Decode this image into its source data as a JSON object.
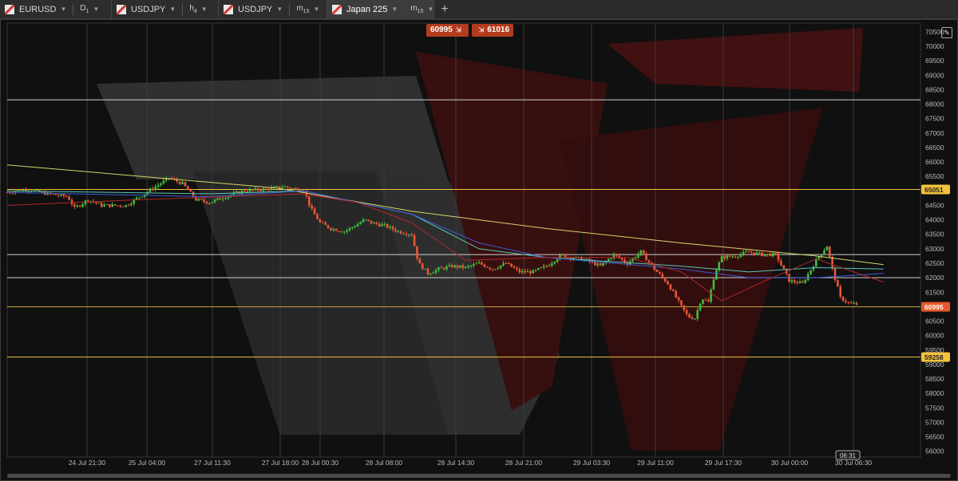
{
  "tabs": [
    {
      "symbol": "EURUSD",
      "timeframe_main": "D",
      "timeframe_sub": "1",
      "active": false
    },
    {
      "symbol": "USDJPY",
      "timeframe_main": "h",
      "timeframe_sub": "4",
      "active": false
    },
    {
      "symbol": "USDJPY",
      "timeframe_main": "m",
      "timeframe_sub": "15",
      "active": false
    },
    {
      "symbol": "Japan 225",
      "timeframe_main": "m",
      "timeframe_sub": "15",
      "active": true
    }
  ],
  "add_tab_label": "+",
  "quotes": {
    "bid": "60995",
    "bid_arrow": "⇲",
    "ask_arrow": "⇲",
    "ask": "61016"
  },
  "settings_icon": "edit-icon",
  "colors": {
    "bull": "#3fbf3f",
    "bear": "#e8583a",
    "ma_yellow": "#d6d46a",
    "ma_blue": "#3a5bd6",
    "ma_red": "#b2282b",
    "ma_cyan": "#56c7b8",
    "bid_badge": "#e8582a",
    "level_badge": "#f2c23c"
  },
  "chart_data": {
    "type": "candlestick",
    "symbol": "Japan 225",
    "timeframe": "m15",
    "y_axis": {
      "ticks": [
        "70500",
        "70000",
        "69500",
        "69000",
        "68500",
        "68000",
        "67500",
        "67000",
        "66500",
        "66000",
        "65500",
        "65000",
        "64500",
        "64000",
        "63500",
        "63000",
        "62500",
        "62000",
        "61500",
        "61000",
        "60500",
        "60000",
        "59500",
        "59000",
        "58500",
        "58000",
        "57500",
        "57000",
        "56500",
        "56000"
      ],
      "range": [
        55800,
        70800
      ]
    },
    "x_axis": {
      "labels": [
        "24 Jul 21:30",
        "25 Jul 04:00",
        "27 Jul 11:30",
        "27 Jul 18:00",
        "28 Jul 00:30",
        "28 Jul 08:00",
        "28 Jul 14:30",
        "28 Jul 21:00",
        "29 Jul 03:30",
        "29 Jul 11:00",
        "29 Jul 17:30",
        "30 Jul 00:00",
        "30 Jul 06:30"
      ],
      "current_marker": "06:31"
    },
    "horizontal_levels": [
      {
        "value": 68150,
        "color": "#d0d0d0",
        "label": ""
      },
      {
        "value": 65051,
        "color": "#f2c23c",
        "label": "65051"
      },
      {
        "value": 62800,
        "color": "#d0d0d0",
        "label": ""
      },
      {
        "value": 62000,
        "color": "#d0d0d0",
        "label": ""
      },
      {
        "value": 60995,
        "color": "#c8a83c",
        "label": "60995"
      },
      {
        "value": 59258,
        "color": "#f2c23c",
        "label": "59258"
      }
    ],
    "anchors": [
      [
        0,
        64950
      ],
      [
        15,
        65050
      ],
      [
        30,
        64900
      ],
      [
        45,
        64800
      ],
      [
        50,
        64400
      ],
      [
        60,
        64700
      ],
      [
        70,
        64500
      ],
      [
        88,
        64500
      ],
      [
        100,
        64850
      ],
      [
        110,
        65150
      ],
      [
        120,
        65450
      ],
      [
        130,
        65250
      ],
      [
        140,
        64700
      ],
      [
        150,
        64600
      ],
      [
        165,
        64850
      ],
      [
        175,
        65000
      ],
      [
        190,
        65050
      ],
      [
        205,
        65150
      ],
      [
        215,
        65050
      ],
      [
        220,
        65050
      ],
      [
        225,
        64400
      ],
      [
        232,
        63900
      ],
      [
        240,
        63700
      ],
      [
        250,
        63600
      ],
      [
        258,
        63800
      ],
      [
        265,
        64000
      ],
      [
        270,
        63900
      ],
      [
        280,
        63800
      ],
      [
        290,
        63600
      ],
      [
        300,
        63500
      ],
      [
        305,
        62500
      ],
      [
        312,
        62150
      ],
      [
        320,
        62300
      ],
      [
        330,
        62400
      ],
      [
        340,
        62350
      ],
      [
        350,
        62500
      ],
      [
        360,
        62300
      ],
      [
        370,
        62500
      ],
      [
        380,
        62200
      ],
      [
        390,
        62200
      ],
      [
        400,
        62400
      ],
      [
        410,
        62750
      ],
      [
        420,
        62700
      ],
      [
        430,
        62600
      ],
      [
        440,
        62400
      ],
      [
        450,
        62800
      ],
      [
        460,
        62500
      ],
      [
        470,
        62900
      ],
      [
        480,
        62300
      ],
      [
        490,
        61800
      ],
      [
        500,
        61000
      ],
      [
        505,
        60650
      ],
      [
        510,
        60600
      ],
      [
        515,
        61300
      ],
      [
        520,
        61150
      ],
      [
        525,
        62200
      ],
      [
        530,
        62700
      ],
      [
        540,
        62750
      ],
      [
        550,
        62900
      ],
      [
        560,
        62800
      ],
      [
        570,
        62800
      ],
      [
        580,
        61900
      ],
      [
        590,
        61800
      ],
      [
        600,
        62600
      ],
      [
        608,
        63100
      ],
      [
        612,
        62300
      ],
      [
        618,
        61300
      ],
      [
        625,
        61100
      ],
      [
        630,
        61080
      ]
    ],
    "ma_yellow": [
      [
        0,
        65900
      ],
      [
        100,
        65500
      ],
      [
        200,
        65100
      ],
      [
        300,
        64300
      ],
      [
        400,
        63700
      ],
      [
        500,
        63200
      ],
      [
        600,
        62750
      ],
      [
        650,
        62450
      ]
    ],
    "ma_blue": [
      [
        0,
        64950
      ],
      [
        150,
        64800
      ],
      [
        220,
        65000
      ],
      [
        300,
        64200
      ],
      [
        350,
        63200
      ],
      [
        400,
        62700
      ],
      [
        450,
        62500
      ],
      [
        500,
        62300
      ],
      [
        550,
        62000
      ],
      [
        600,
        62000
      ],
      [
        650,
        62150
      ]
    ],
    "ma_red": [
      [
        0,
        64500
      ],
      [
        100,
        64700
      ],
      [
        220,
        64900
      ],
      [
        260,
        64600
      ],
      [
        300,
        63900
      ],
      [
        340,
        62600
      ],
      [
        400,
        62700
      ],
      [
        460,
        62700
      ],
      [
        500,
        62200
      ],
      [
        530,
        61200
      ],
      [
        560,
        61850
      ],
      [
        600,
        62650
      ],
      [
        650,
        61850
      ]
    ],
    "ma_cyan": [
      [
        0,
        65000
      ],
      [
        150,
        64900
      ],
      [
        220,
        65000
      ],
      [
        300,
        64200
      ],
      [
        350,
        63000
      ],
      [
        400,
        62700
      ],
      [
        450,
        62550
      ],
      [
        500,
        62400
      ],
      [
        550,
        62200
      ],
      [
        600,
        62350
      ],
      [
        650,
        62300
      ]
    ]
  }
}
